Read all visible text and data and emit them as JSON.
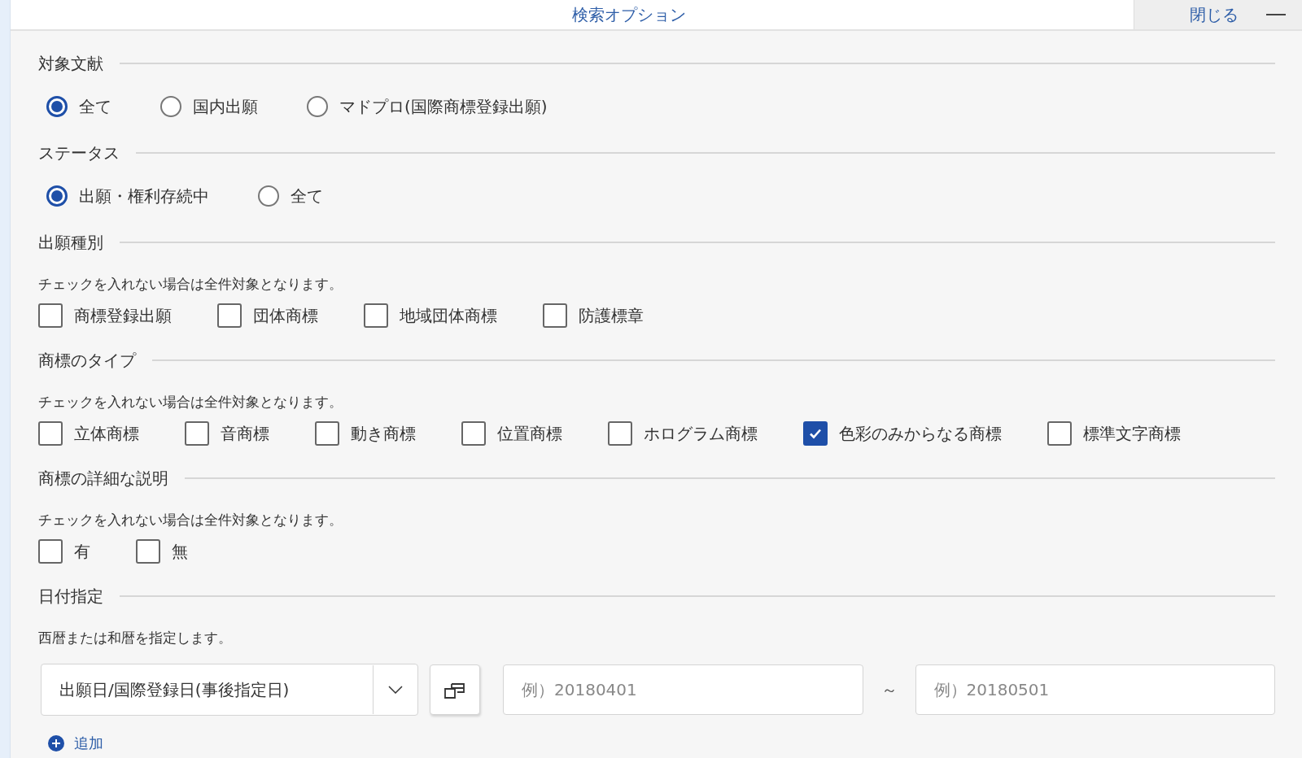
{
  "header": {
    "title": "検索オプション",
    "close_label": "閉じる"
  },
  "sections": [
    {
      "title": "対象文献",
      "kind": "radio",
      "options": [
        {
          "label": "全て",
          "selected": true
        },
        {
          "label": "国内出願",
          "selected": false
        },
        {
          "label": "マドプロ(国際商標登録出願)",
          "selected": false
        }
      ]
    },
    {
      "title": "ステータス",
      "kind": "radio",
      "options": [
        {
          "label": "出願・権利存続中",
          "selected": true
        },
        {
          "label": "全て",
          "selected": false
        }
      ]
    },
    {
      "title": "出願種別",
      "kind": "checkbox",
      "note": "チェックを入れない場合は全件対象となります。",
      "options": [
        {
          "label": "商標登録出願",
          "checked": false
        },
        {
          "label": "団体商標",
          "checked": false
        },
        {
          "label": "地域団体商標",
          "checked": false
        },
        {
          "label": "防護標章",
          "checked": false
        }
      ]
    },
    {
      "title": "商標のタイプ",
      "kind": "checkbox",
      "note": "チェックを入れない場合は全件対象となります。",
      "options": [
        {
          "label": "立体商標",
          "checked": false
        },
        {
          "label": "音商標",
          "checked": false
        },
        {
          "label": "動き商標",
          "checked": false
        },
        {
          "label": "位置商標",
          "checked": false
        },
        {
          "label": "ホログラム商標",
          "checked": false
        },
        {
          "label": "色彩のみからなる商標",
          "checked": true
        },
        {
          "label": "標準文字商標",
          "checked": false
        }
      ]
    },
    {
      "title": "商標の詳細な説明",
      "kind": "checkbox",
      "note": "チェックを入れない場合は全件対象となります。",
      "options": [
        {
          "label": "有",
          "checked": false
        },
        {
          "label": "無",
          "checked": false
        }
      ]
    }
  ],
  "date": {
    "title": "日付指定",
    "note": "西暦または和暦を指定します。",
    "select_value": "出願日/国際登録日(事後指定日)",
    "from_placeholder": "例）20180401",
    "separator": "～",
    "to_placeholder": "例）20180501",
    "add_label": "追加"
  }
}
